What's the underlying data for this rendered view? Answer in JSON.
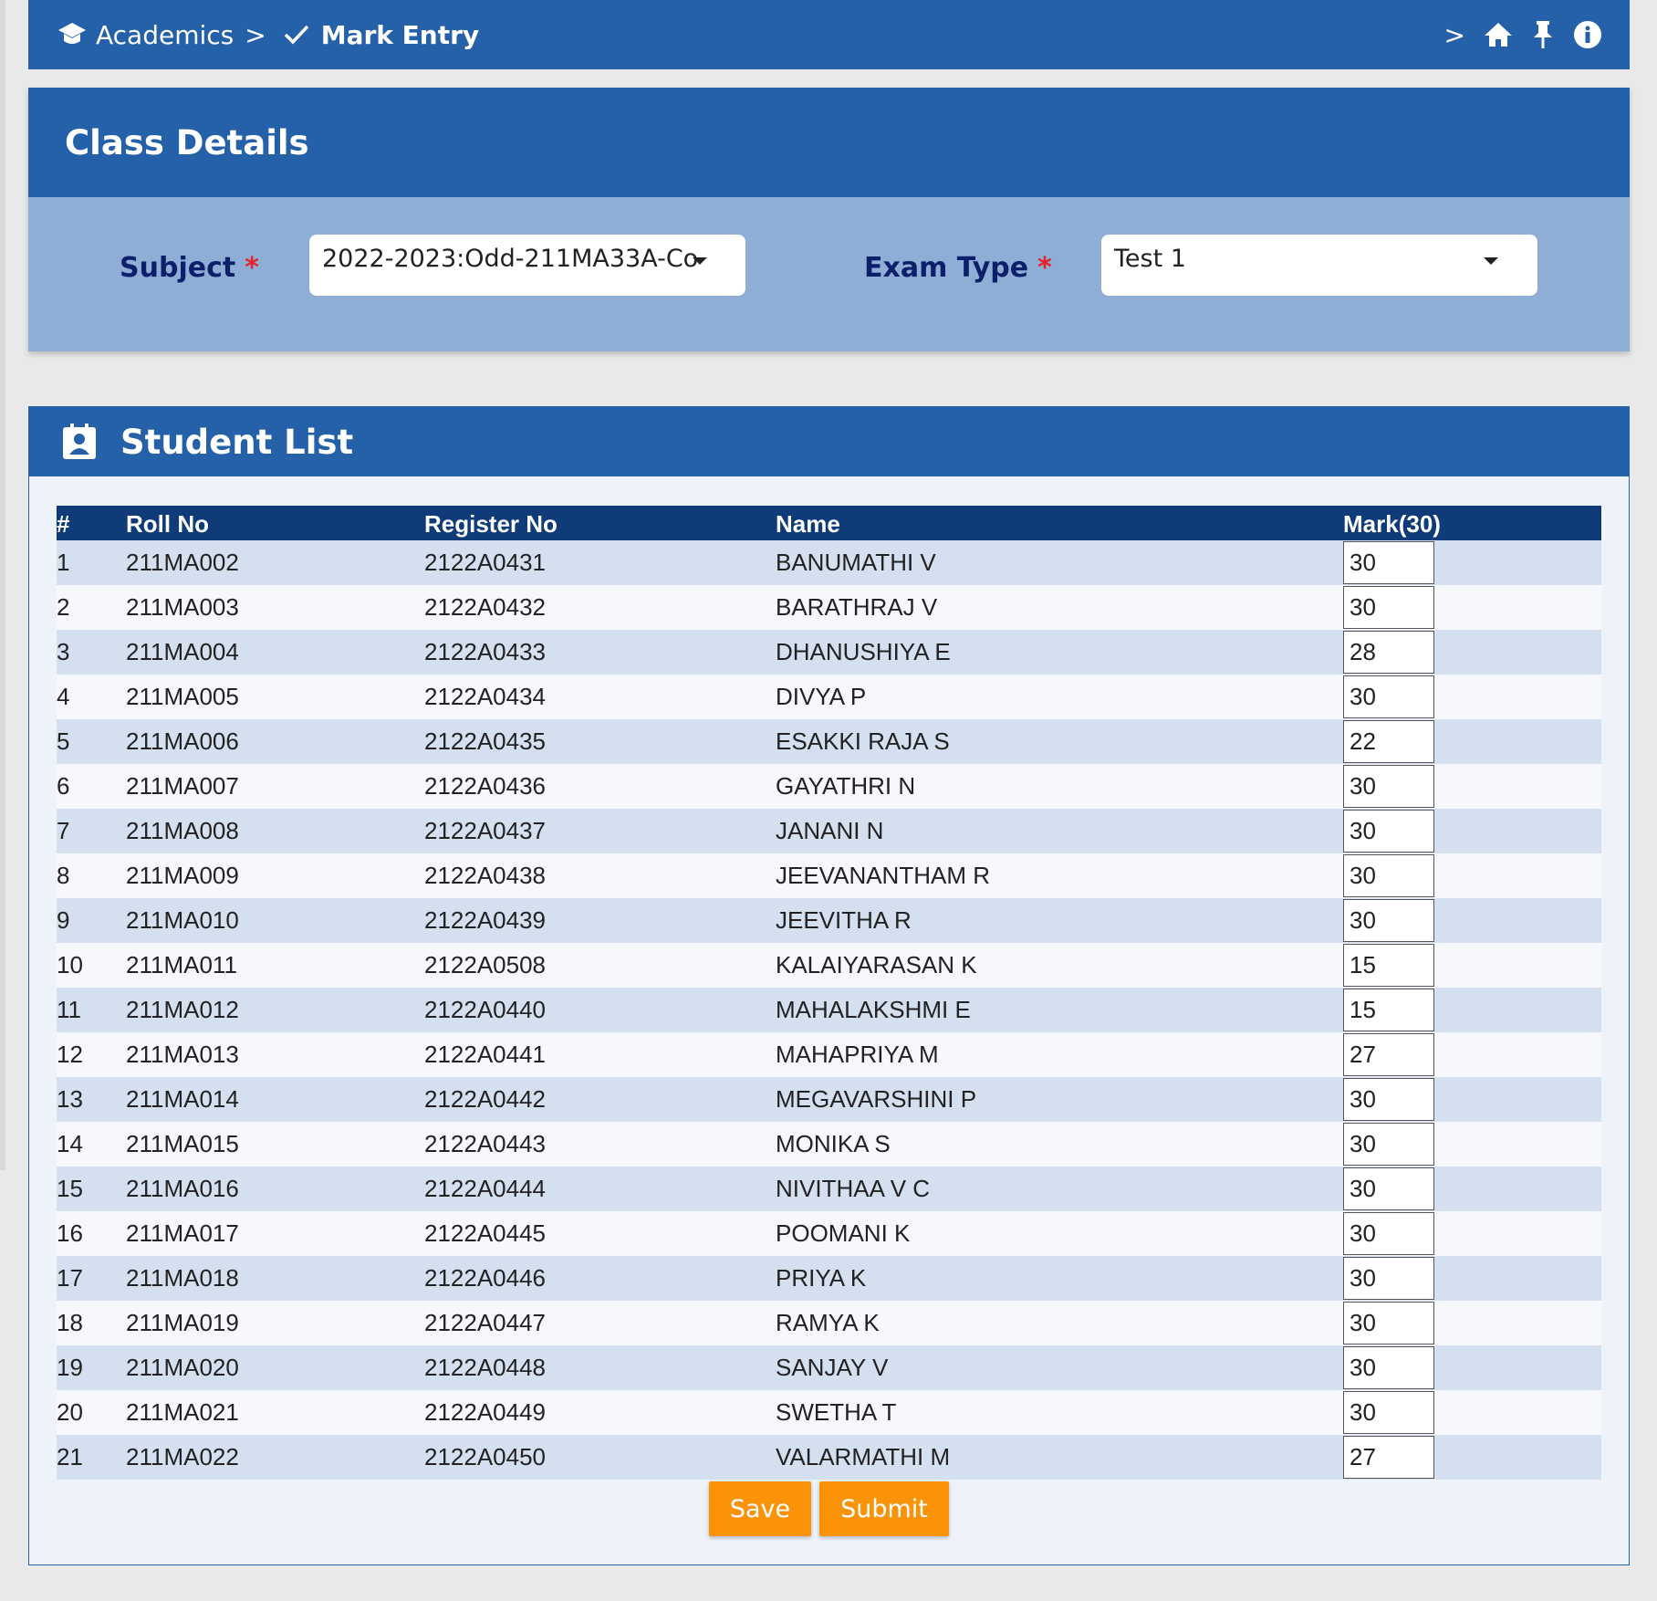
{
  "breadcrumb": {
    "parent": "Academics",
    "separator": ">",
    "current": "Mark Entry",
    "more": ">"
  },
  "icons": {
    "parent": "graduation-cap-icon",
    "current": "check-icon",
    "home": "home-icon",
    "pin": "pin-icon",
    "info": "info-icon",
    "student_list": "contact-badge-icon"
  },
  "colors": {
    "header_blue": "#2561a8",
    "table_header": "#0f3c78",
    "form_panel": "#8eaed6",
    "required": "#e8202a",
    "button_orange": "#fb9309"
  },
  "class_details": {
    "title": "Class Details",
    "subject_label": "Subject",
    "subject_value": "2022-2023:Odd-211MA33A-Co",
    "exam_type_label": "Exam Type",
    "exam_type_value": "Test 1",
    "required_marker": "*"
  },
  "student_list": {
    "title": "Student List",
    "columns": [
      "#",
      "Roll No",
      "Register No",
      "Name",
      "Mark(30)"
    ],
    "rows": [
      {
        "no": "1",
        "roll": "211MA002",
        "reg": "2122A0431",
        "name": "BANUMATHI V",
        "mark": "30"
      },
      {
        "no": "2",
        "roll": "211MA003",
        "reg": "2122A0432",
        "name": "BARATHRAJ V",
        "mark": "30"
      },
      {
        "no": "3",
        "roll": "211MA004",
        "reg": "2122A0433",
        "name": "DHANUSHIYA E",
        "mark": "28"
      },
      {
        "no": "4",
        "roll": "211MA005",
        "reg": "2122A0434",
        "name": "DIVYA P",
        "mark": "30"
      },
      {
        "no": "5",
        "roll": "211MA006",
        "reg": "2122A0435",
        "name": "ESAKKI RAJA S",
        "mark": "22"
      },
      {
        "no": "6",
        "roll": "211MA007",
        "reg": "2122A0436",
        "name": "GAYATHRI N",
        "mark": "30"
      },
      {
        "no": "7",
        "roll": "211MA008",
        "reg": "2122A0437",
        "name": "JANANI N",
        "mark": "30"
      },
      {
        "no": "8",
        "roll": "211MA009",
        "reg": "2122A0438",
        "name": "JEEVANANTHAM R",
        "mark": "30"
      },
      {
        "no": "9",
        "roll": "211MA010",
        "reg": "2122A0439",
        "name": "JEEVITHA R",
        "mark": "30"
      },
      {
        "no": "10",
        "roll": "211MA011",
        "reg": "2122A0508",
        "name": "KALAIYARASAN K",
        "mark": "15"
      },
      {
        "no": "11",
        "roll": "211MA012",
        "reg": "2122A0440",
        "name": "MAHALAKSHMI E",
        "mark": "15"
      },
      {
        "no": "12",
        "roll": "211MA013",
        "reg": "2122A0441",
        "name": "MAHAPRIYA M",
        "mark": "27"
      },
      {
        "no": "13",
        "roll": "211MA014",
        "reg": "2122A0442",
        "name": "MEGAVARSHINI P",
        "mark": "30"
      },
      {
        "no": "14",
        "roll": "211MA015",
        "reg": "2122A0443",
        "name": "MONIKA S",
        "mark": "30"
      },
      {
        "no": "15",
        "roll": "211MA016",
        "reg": "2122A0444",
        "name": "NIVITHAA V C",
        "mark": "30"
      },
      {
        "no": "16",
        "roll": "211MA017",
        "reg": "2122A0445",
        "name": "POOMANI K",
        "mark": "30"
      },
      {
        "no": "17",
        "roll": "211MA018",
        "reg": "2122A0446",
        "name": "PRIYA K",
        "mark": "30"
      },
      {
        "no": "18",
        "roll": "211MA019",
        "reg": "2122A0447",
        "name": "RAMYA K",
        "mark": "30"
      },
      {
        "no": "19",
        "roll": "211MA020",
        "reg": "2122A0448",
        "name": "SANJAY V",
        "mark": "30"
      },
      {
        "no": "20",
        "roll": "211MA021",
        "reg": "2122A0449",
        "name": "SWETHA T",
        "mark": "30"
      },
      {
        "no": "21",
        "roll": "211MA022",
        "reg": "2122A0450",
        "name": "VALARMATHI M",
        "mark": "27"
      }
    ]
  },
  "actions": {
    "save_label": "Save",
    "submit_label": "Submit"
  }
}
